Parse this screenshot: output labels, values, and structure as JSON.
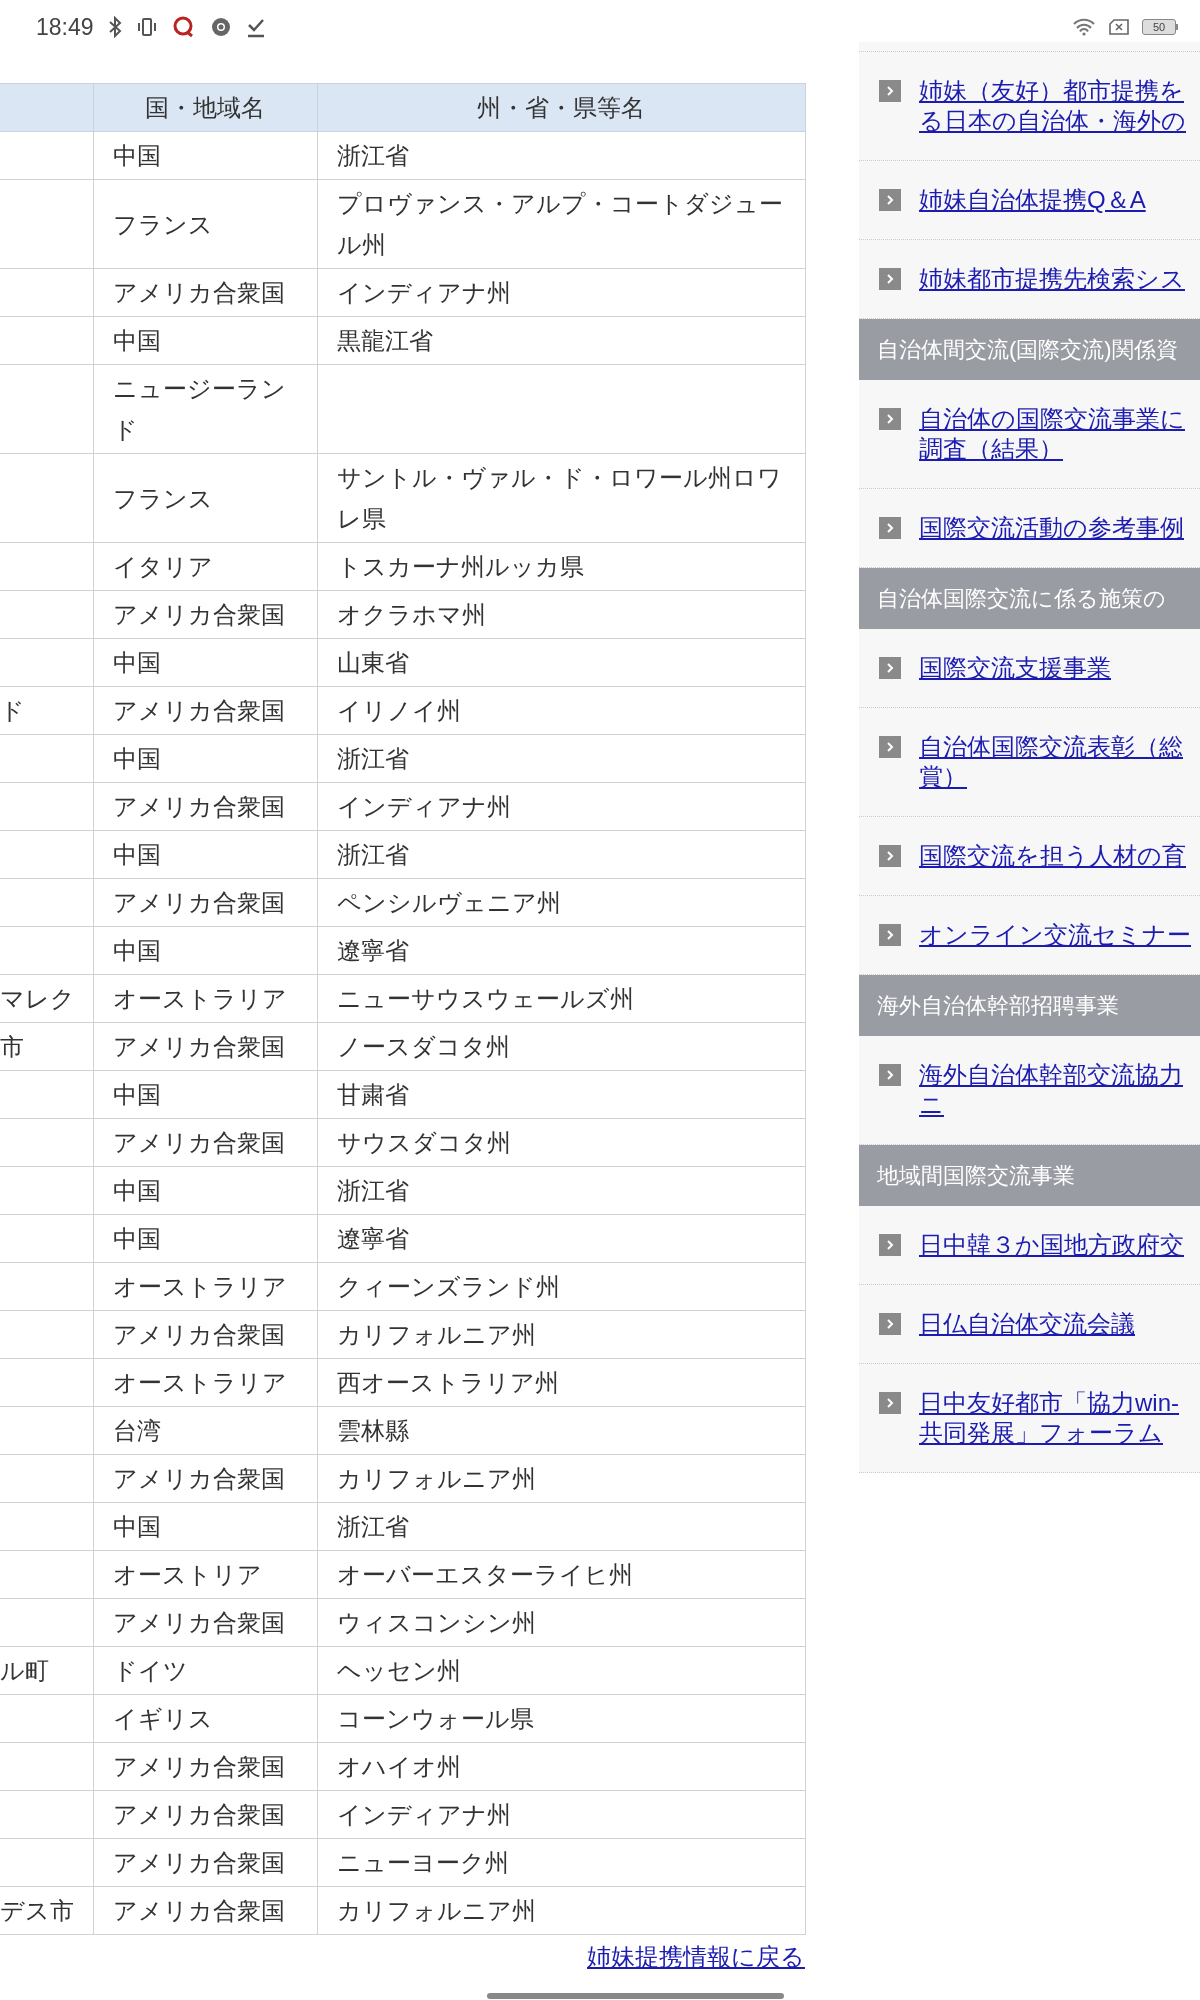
{
  "status_bar": {
    "time": "18:49",
    "battery": "50"
  },
  "table": {
    "columns": [
      "国・地域名",
      "州・省・県等名"
    ],
    "rows": [
      {
        "column_1": "",
        "country": "中国",
        "region": "浙江省"
      },
      {
        "column_1": "",
        "country": "フランス",
        "region": "プロヴァンス・アルプ・コートダジュール州"
      },
      {
        "column_1": "",
        "country": "アメリカ合衆国",
        "region": "インディアナ州"
      },
      {
        "column_1": "",
        "country": "中国",
        "region": "黒龍江省"
      },
      {
        "column_1": "",
        "country": "ニュージーランド",
        "region": ""
      },
      {
        "column_1": "",
        "country": "フランス",
        "region": "サントル・ヴァル・ド・ロワール州ロワレ県"
      },
      {
        "column_1": "",
        "country": "イタリア",
        "region": "トスカーナ州ルッカ県"
      },
      {
        "column_1": "",
        "country": "アメリカ合衆国",
        "region": "オクラホマ州"
      },
      {
        "column_1": "",
        "country": "中国",
        "region": "山東省"
      },
      {
        "column_1": "ド",
        "country": "アメリカ合衆国",
        "region": "イリノイ州"
      },
      {
        "column_1": "",
        "country": "中国",
        "region": "浙江省"
      },
      {
        "column_1": "",
        "country": "アメリカ合衆国",
        "region": "インディアナ州"
      },
      {
        "column_1": "",
        "country": "中国",
        "region": "浙江省"
      },
      {
        "column_1": "",
        "country": "アメリカ合衆国",
        "region": "ペンシルヴェニア州"
      },
      {
        "column_1": "",
        "country": "中国",
        "region": "遼寧省"
      },
      {
        "column_1": "マレク",
        "country": "オーストラリア",
        "region": "ニューサウスウェールズ州"
      },
      {
        "column_1": "市",
        "country": "アメリカ合衆国",
        "region": "ノースダコタ州"
      },
      {
        "column_1": "",
        "country": "中国",
        "region": "甘粛省"
      },
      {
        "column_1": "",
        "country": "アメリカ合衆国",
        "region": "サウスダコタ州"
      },
      {
        "column_1": "",
        "country": "中国",
        "region": "浙江省"
      },
      {
        "column_1": "",
        "country": "中国",
        "region": "遼寧省"
      },
      {
        "column_1": "",
        "country": "オーストラリア",
        "region": "クィーンズランド州"
      },
      {
        "column_1": "",
        "country": "アメリカ合衆国",
        "region": "カリフォルニア州"
      },
      {
        "column_1": "",
        "country": "オーストラリア",
        "region": "西オーストラリア州"
      },
      {
        "column_1": "",
        "country": "台湾",
        "region": "雲林縣"
      },
      {
        "column_1": "",
        "country": "アメリカ合衆国",
        "region": "カリフォルニア州"
      },
      {
        "column_1": "",
        "country": "中国",
        "region": "浙江省"
      },
      {
        "column_1": "",
        "country": "オーストリア",
        "region": "オーバーエスターライヒ州"
      },
      {
        "column_1": "",
        "country": "アメリカ合衆国",
        "region": "ウィスコンシン州"
      },
      {
        "column_1": "ル町",
        "country": "ドイツ",
        "region": "ヘッセン州"
      },
      {
        "column_1": "",
        "country": "イギリス",
        "region": "コーンウォール県"
      },
      {
        "column_1": "",
        "country": "アメリカ合衆国",
        "region": "オハイオ州"
      },
      {
        "column_1": "",
        "country": "アメリカ合衆国",
        "region": "インディアナ州"
      },
      {
        "column_1": "",
        "country": "アメリカ合衆国",
        "region": "ニューヨーク州"
      },
      {
        "column_1": "デス市",
        "country": "アメリカ合衆国",
        "region": "カリフォルニア州"
      }
    ]
  },
  "back_link": "姉妹提携情報に戻る",
  "sidebar": {
    "items": [
      {
        "kind": "link",
        "lines": [
          "姉妹（友好）都市提携を",
          "る日本の自治体・海外の"
        ]
      },
      {
        "kind": "link",
        "lines": [
          "姉妹自治体提携Q＆A"
        ]
      },
      {
        "kind": "link",
        "lines": [
          "姉妹都市提携先検索シス"
        ]
      },
      {
        "kind": "heading",
        "text": "自治体間交流(国際交流)関係資"
      },
      {
        "kind": "link",
        "lines": [
          "自治体の国際交流事業に",
          "調査（結果）"
        ]
      },
      {
        "kind": "link",
        "lines": [
          "国際交流活動の参考事例"
        ]
      },
      {
        "kind": "heading",
        "text": "自治体国際交流に係る施策の"
      },
      {
        "kind": "link",
        "lines": [
          "国際交流支援事業"
        ]
      },
      {
        "kind": "link",
        "lines": [
          "自治体国際交流表彰（総",
          "賞）"
        ]
      },
      {
        "kind": "link",
        "lines": [
          "国際交流を担う人材の育"
        ]
      },
      {
        "kind": "link",
        "lines": [
          "オンライン交流セミナー"
        ]
      },
      {
        "kind": "heading",
        "text": "海外自治体幹部招聘事業"
      },
      {
        "kind": "link",
        "lines": [
          "海外自治体幹部交流協力",
          "ニ"
        ]
      },
      {
        "kind": "heading",
        "text": "地域間国際交流事業"
      },
      {
        "kind": "link",
        "lines": [
          "日中韓３か国地方政府交"
        ]
      },
      {
        "kind": "link",
        "lines": [
          "日仏自治体交流会議"
        ]
      },
      {
        "kind": "link",
        "lines": [
          "日中友好都市「協力win-",
          "共同発展」フォーラム"
        ]
      }
    ]
  }
}
